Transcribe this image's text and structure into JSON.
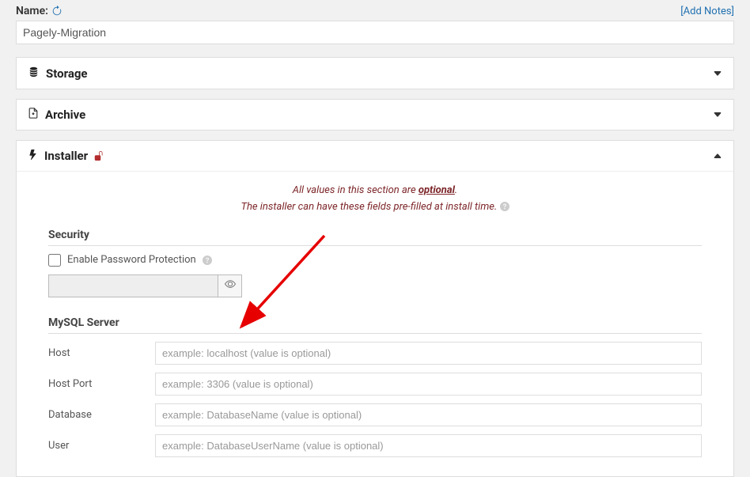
{
  "name": {
    "label": "Name:",
    "value": "Pagely-Migration",
    "add_notes": "[Add Notes]"
  },
  "panels": {
    "storage": {
      "title": "Storage"
    },
    "archive": {
      "title": "Archive"
    },
    "installer": {
      "title": "Installer",
      "notice_line1_prefix": "All values in this section are ",
      "notice_line1_bold": "optional",
      "notice_line1_suffix": ".",
      "notice_line2": "The installer can have these fields pre-filled at install time."
    }
  },
  "security": {
    "heading": "Security",
    "checkbox_label": "Enable Password Protection"
  },
  "mysql": {
    "heading": "MySQL Server",
    "fields": {
      "host": {
        "label": "Host",
        "placeholder": "example: localhost (value is optional)"
      },
      "host_port": {
        "label": "Host Port",
        "placeholder": "example: 3306 (value is optional)"
      },
      "database": {
        "label": "Database",
        "placeholder": "example: DatabaseName (value is optional)"
      },
      "user": {
        "label": "User",
        "placeholder": "example: DatabaseUserName (value is optional)"
      }
    }
  }
}
